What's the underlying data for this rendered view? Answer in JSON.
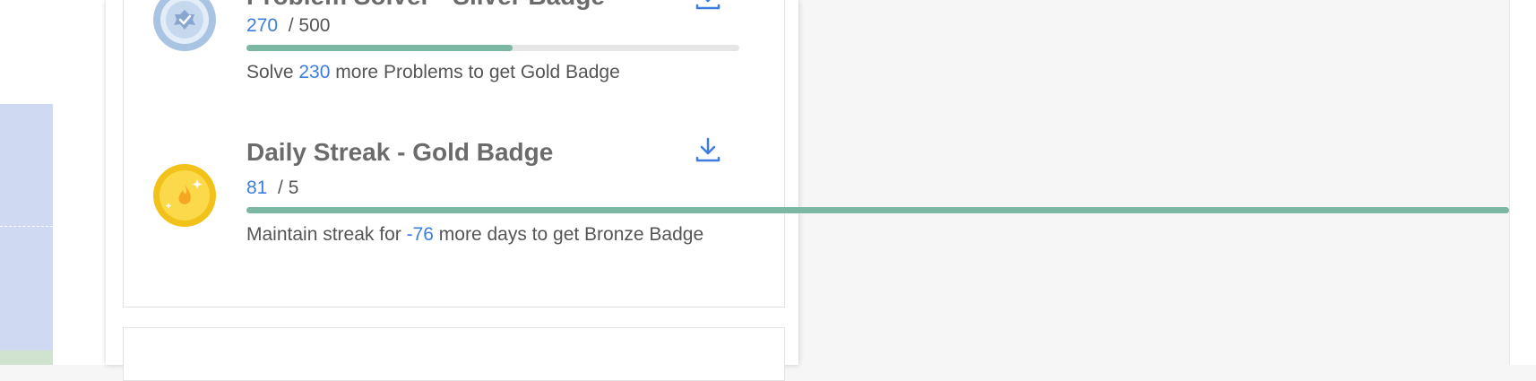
{
  "badges": [
    {
      "title": "Problem Solver - Silver Badge",
      "current": "270",
      "total": "/ 500",
      "progress_fraction": 0.54,
      "desc_prefix": "Solve",
      "desc_value": "230",
      "desc_suffix": "more Problems to get Gold Badge",
      "icon": "silver-badge-icon"
    },
    {
      "title": "Daily Streak - Gold Badge",
      "current": "81",
      "total": "/ 5",
      "progress_fraction": 16.2,
      "desc_prefix": "Maintain streak for",
      "desc_value": "-76",
      "desc_suffix": "more days to get Bronze Badge",
      "icon": "gold-badge-icon"
    }
  ],
  "colors": {
    "accent_blue": "#3d7de0",
    "progress_green": "#7bb7a2",
    "title_gray": "#6b6b6b"
  }
}
